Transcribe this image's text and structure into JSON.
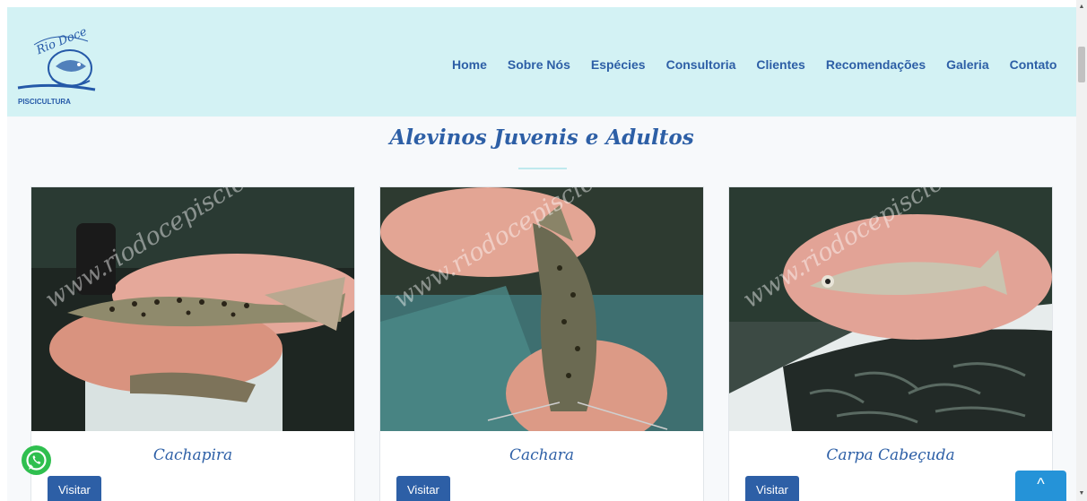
{
  "header": {
    "logo_text": "PISCICULTURA",
    "logo_script": "Rio Doce",
    "nav": [
      "Home",
      "Sobre Nós",
      "Espécies",
      "Consultoria",
      "Clientes",
      "Recomendações",
      "Galeria",
      "Contato"
    ]
  },
  "section": {
    "title": "Alevinos Juvenis e Adultos"
  },
  "cards": [
    {
      "name": "Cachapira",
      "button": "Visitar",
      "watermark": "www.riodocepiscicultura.com.br"
    },
    {
      "name": "Cachara",
      "button": "Visitar",
      "watermark": "www.riodocepiscicultura.com.br"
    },
    {
      "name": "Carpa Cabeçuda",
      "button": "Visitar",
      "watermark": "www.riodocepiscicultura.com.br"
    }
  ],
  "floating": {
    "whatsapp_icon": "whatsapp-icon",
    "back_to_top": "^"
  },
  "scrollbar": {
    "up": "▲",
    "down": "▼"
  },
  "colors": {
    "header_bg": "#d3f2f4",
    "accent": "#2d5fa6",
    "back_top": "#2593d8",
    "whatsapp": "#2fbf4f"
  }
}
